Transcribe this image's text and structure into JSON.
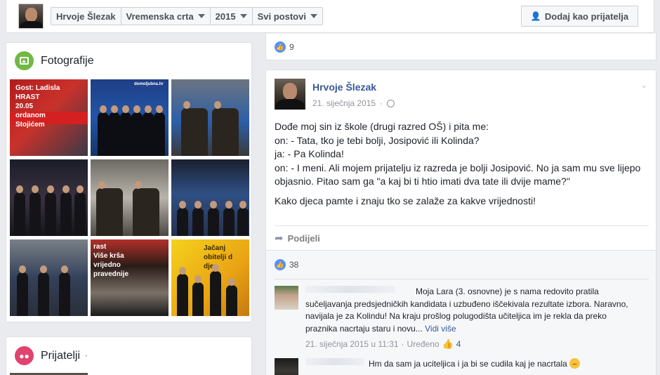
{
  "header": {
    "breadcrumbs": [
      {
        "label": "Hrvoje Šlezak",
        "dropdown": false
      },
      {
        "label": "Vremenska crta",
        "dropdown": true
      },
      {
        "label": "2015",
        "dropdown": true
      },
      {
        "label": "Svi postovi",
        "dropdown": true
      }
    ],
    "add_friend_label": "Dodaj kao prijatelja"
  },
  "photos": {
    "title": "Fotografije",
    "tiles": [
      {
        "caption": "Gost: Ladisla\nHRAST\n20.05\nordanom\nStojićem"
      },
      {
        "caption": "domoljubna.hr"
      },
      {
        "caption": ""
      },
      {
        "caption": ""
      },
      {
        "caption": ""
      },
      {
        "caption": ""
      },
      {
        "caption": ""
      },
      {
        "caption": "rast\nViše krša\nvrijedno\npravednije"
      },
      {
        "caption": "Jačanj\nobitelji d\ndjec"
      }
    ]
  },
  "friends": {
    "title": "Prijatelji",
    "separator": "·"
  },
  "prev_post": {
    "likes": "9"
  },
  "post": {
    "author": "Hrvoje Šlezak",
    "date": "21. siječnja 2015",
    "separator": "·",
    "lines": [
      "Dođe moj sin iz škole (drugi razred OŠ) i pita me:",
      "on: - Tata, tko je tebi bolji, Josipović ili Kolinda?",
      "ja: - Pa Kolinda!",
      "on: - I meni. Ali mojem prijatelju iz razreda je bolji Josipović. No ja sam mu sve lijepo objasnio. Pitao sam ga \"a kaj bi ti htio imati dva tate ili dvije mame?\""
    ],
    "closing": "Kako djeca pamte i znaju tko se zalaže za kakve vrijednosti!",
    "share_label": "Podijeli",
    "likes": "38"
  },
  "comments": [
    {
      "text": "Moja Lara (3. osnovne) je s nama redovito pratila sučeljavanja predsjedničkih kandidata i uzbuđeno iščekivala rezultate izbora. Naravno, navijala je za Kolindu! Na kraju prošlog polugodišta učiteljica im je rekla da preko praznika nacrtaju staru i novu...",
      "more": "Vidi više",
      "timestamp": "21. siječnja 2015 u 11:31",
      "dot": "·",
      "edited": "Uređeno",
      "likes": "4"
    },
    {
      "text": "Hm da sam ja uciteljica i ja bi se cudila kaj je nacrtala"
    }
  ],
  "colors": {
    "link": "#365899",
    "like_blue": "#5890ff",
    "photos_badge": "#72b843",
    "friends_badge": "#e0436d"
  }
}
